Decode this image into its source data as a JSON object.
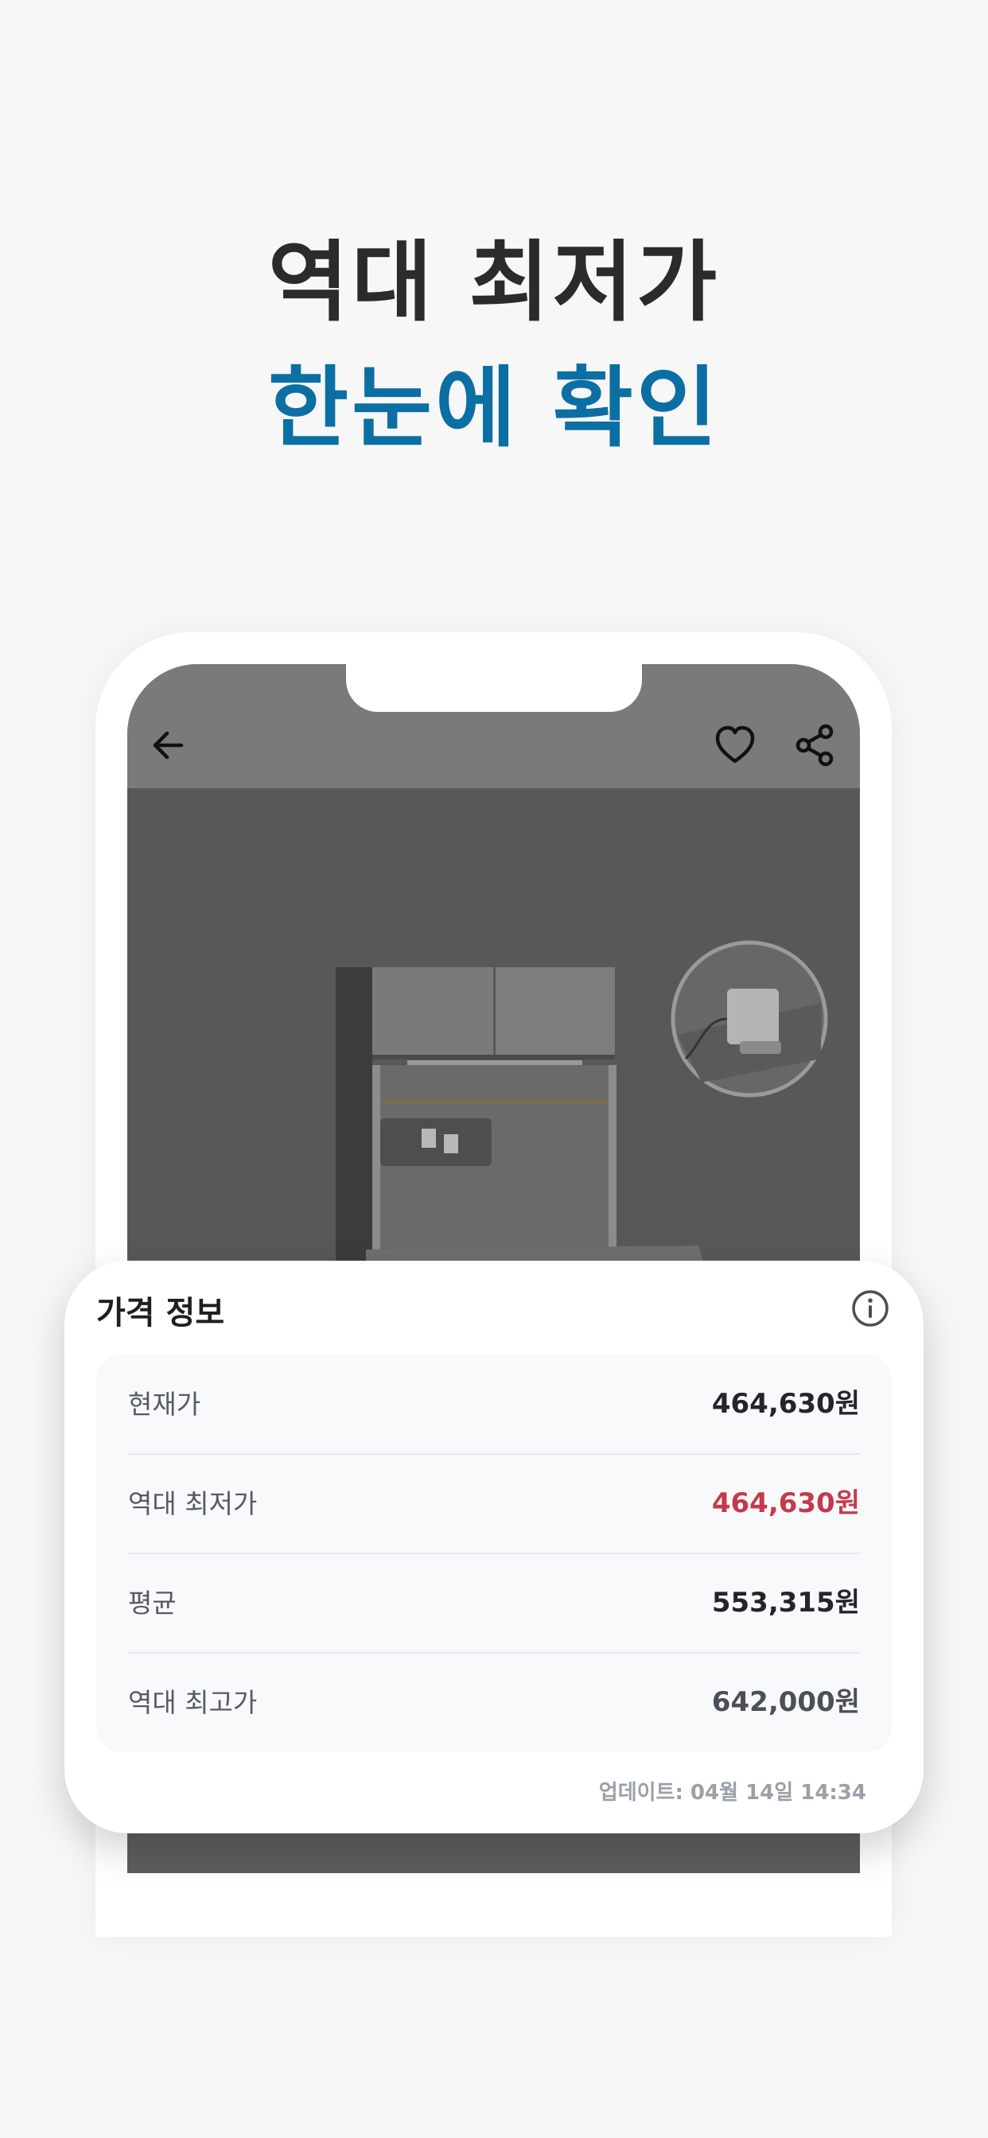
{
  "headline": {
    "line1": "역대 최저가",
    "line2": "한눈에 확인"
  },
  "colors": {
    "headline_dark": "#2b2b2b",
    "headline_accent": "#0b6fa4",
    "lowest_price": "#c43a4b"
  },
  "app_header": {
    "icons": [
      "back-arrow-icon",
      "heart-icon",
      "share-icon"
    ]
  },
  "price_info": {
    "title": "가격 정보",
    "info_icon": "info-icon",
    "rows": [
      {
        "label": "현재가",
        "value": "464,630원"
      },
      {
        "label": "역대 최저가",
        "value": "464,630원"
      },
      {
        "label": "평균",
        "value": "553,315원"
      },
      {
        "label": "역대 최고가",
        "value": "642,000원"
      }
    ],
    "updated": "업데이트: 04월 14일 14:34"
  }
}
